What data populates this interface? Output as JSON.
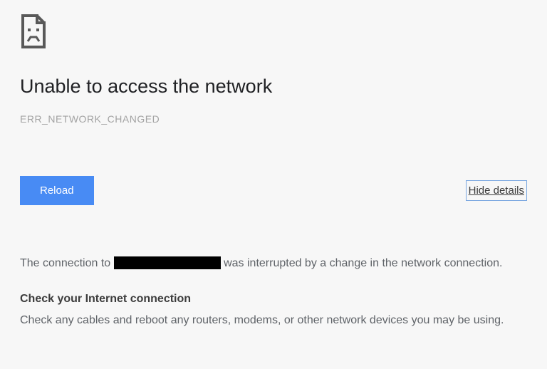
{
  "title": "Unable to access the network",
  "error_code": "ERR_NETWORK_CHANGED",
  "buttons": {
    "reload": "Reload",
    "hide_details": "Hide details"
  },
  "details": {
    "prefix": "The connection to ",
    "suffix": "was interrupted by a change in the network connection."
  },
  "check": {
    "heading": "Check your Internet connection",
    "body": "Check any cables and reboot any routers, modems, or other network devices you may be using."
  }
}
